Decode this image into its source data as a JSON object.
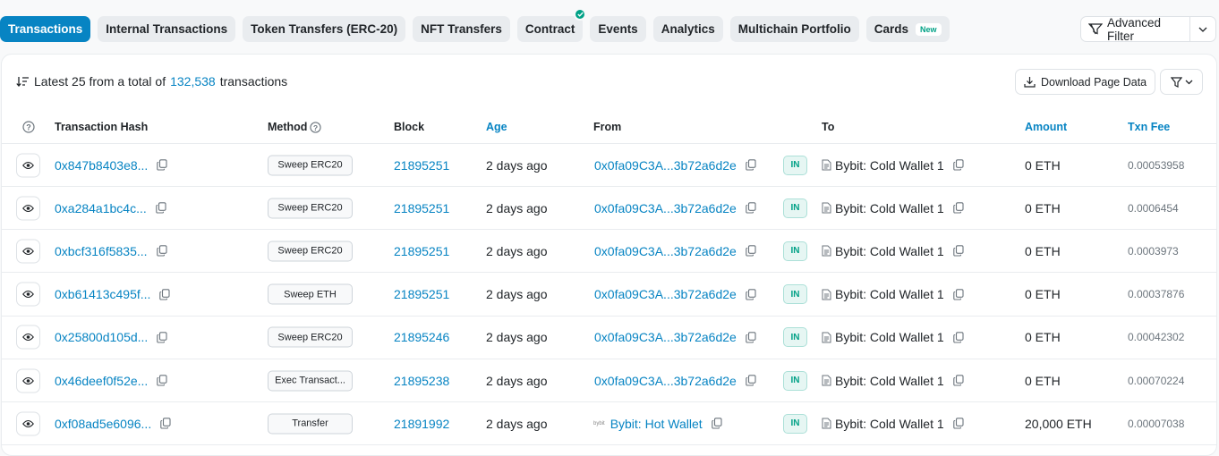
{
  "tabs": [
    {
      "label": "Transactions",
      "active": true
    },
    {
      "label": "Internal Transactions"
    },
    {
      "label": "Token Transfers (ERC-20)"
    },
    {
      "label": "NFT Transfers"
    },
    {
      "label": "Contract",
      "verified": true
    },
    {
      "label": "Events"
    },
    {
      "label": "Analytics"
    },
    {
      "label": "Multichain Portfolio"
    },
    {
      "label": "Cards",
      "badge": "New"
    }
  ],
  "advanced_filter": {
    "label": "Advanced Filter"
  },
  "summary": {
    "prefix": "Latest 25 from a total of",
    "count": "132,538",
    "suffix": "transactions"
  },
  "download_label": "Download Page Data",
  "columns": {
    "hash": "Transaction Hash",
    "method": "Method",
    "block": "Block",
    "age": "Age",
    "from": "From",
    "to": "To",
    "amount": "Amount",
    "fee": "Txn Fee"
  },
  "rows": [
    {
      "hash": "0x847b8403e8...",
      "method": "Sweep ERC20",
      "block": "21895251",
      "age": "2 days ago",
      "from": "0x0fa09C3A...3b72a6d2e",
      "direction": "IN",
      "to": "Bybit: Cold Wallet 1",
      "amount": "0 ETH",
      "fee": "0.00053958"
    },
    {
      "hash": "0xa284a1bc4c...",
      "method": "Sweep ERC20",
      "block": "21895251",
      "age": "2 days ago",
      "from": "0x0fa09C3A...3b72a6d2e",
      "direction": "IN",
      "to": "Bybit: Cold Wallet 1",
      "amount": "0 ETH",
      "fee": "0.0006454"
    },
    {
      "hash": "0xbcf316f5835...",
      "method": "Sweep ERC20",
      "block": "21895251",
      "age": "2 days ago",
      "from": "0x0fa09C3A...3b72a6d2e",
      "direction": "IN",
      "to": "Bybit: Cold Wallet 1",
      "amount": "0 ETH",
      "fee": "0.0003973"
    },
    {
      "hash": "0xb61413c495f...",
      "method": "Sweep ETH",
      "block": "21895251",
      "age": "2 days ago",
      "from": "0x0fa09C3A...3b72a6d2e",
      "direction": "IN",
      "to": "Bybit: Cold Wallet 1",
      "amount": "0 ETH",
      "fee": "0.00037876"
    },
    {
      "hash": "0x25800d105d...",
      "method": "Sweep ERC20",
      "block": "21895246",
      "age": "2 days ago",
      "from": "0x0fa09C3A...3b72a6d2e",
      "direction": "IN",
      "to": "Bybit: Cold Wallet 1",
      "amount": "0 ETH",
      "fee": "0.00042302"
    },
    {
      "hash": "0x46deef0f52e...",
      "method": "Exec Transact...",
      "block": "21895238",
      "age": "2 days ago",
      "from": "0x0fa09C3A...3b72a6d2e",
      "direction": "IN",
      "to": "Bybit: Cold Wallet 1",
      "amount": "0 ETH",
      "fee": "0.00070224"
    },
    {
      "hash": "0xf08ad5e6096...",
      "method": "Transfer",
      "block": "21891992",
      "age": "2 days ago",
      "from": "Bybit: Hot Wallet",
      "from_icon": "bybit-logo-icon",
      "direction": "IN",
      "to": "Bybit: Cold Wallet 1",
      "amount": "20,000 ETH",
      "fee": "0.00007038"
    }
  ],
  "colors": {
    "accent": "#0784c3",
    "in_badge": "#00a186"
  }
}
